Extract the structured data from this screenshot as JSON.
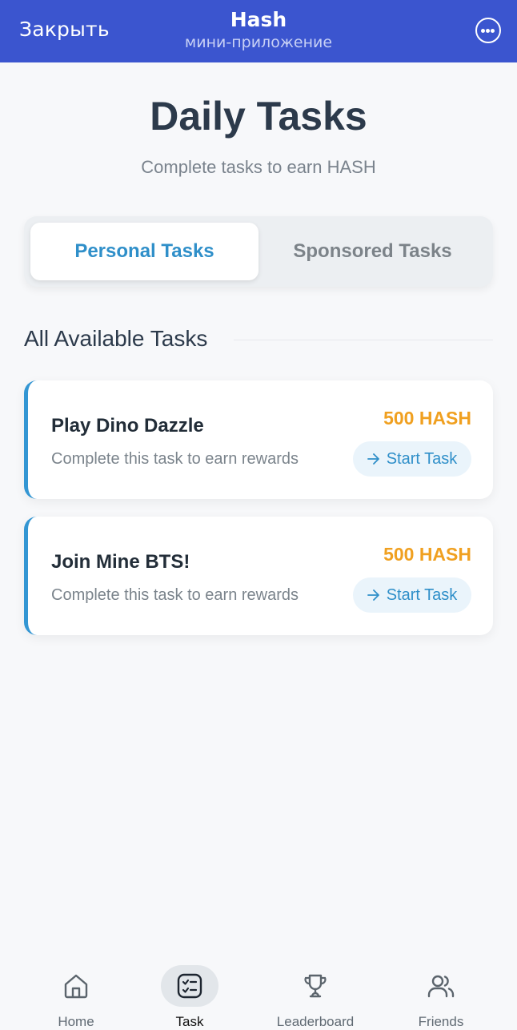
{
  "topbar": {
    "close_label": "Закрыть",
    "title": "Hash",
    "subtitle": "мини-приложение",
    "more_icon": "more-icon"
  },
  "header": {
    "title": "Daily Tasks",
    "subtitle": "Complete tasks to earn HASH"
  },
  "tabs": [
    {
      "label": "Personal Tasks",
      "active": true
    },
    {
      "label": "Sponsored Tasks",
      "active": false
    }
  ],
  "section": {
    "title": "All Available Tasks"
  },
  "tasks": [
    {
      "name": "Play Dino Dazzle",
      "description": "Complete this task to earn rewards",
      "reward": "500 HASH",
      "button_label": "Start Task",
      "button_icon": "arrow-right-icon"
    },
    {
      "name": "Join Mine BTS!",
      "description": "Complete this task to earn rewards",
      "reward": "500 HASH",
      "button_label": "Start Task",
      "button_icon": "arrow-right-icon"
    }
  ],
  "bottom_nav": [
    {
      "label": "Home",
      "icon": "home-icon",
      "active": false
    },
    {
      "label": "Task",
      "icon": "task-list-icon",
      "active": true
    },
    {
      "label": "Leaderboard",
      "icon": "trophy-icon",
      "active": false
    },
    {
      "label": "Friends",
      "icon": "friends-icon",
      "active": false
    }
  ],
  "colors": {
    "topbar": "#3b55cf",
    "accent": "#2f8fc9",
    "reward": "#f0a020",
    "card_border": "#3396d3"
  }
}
